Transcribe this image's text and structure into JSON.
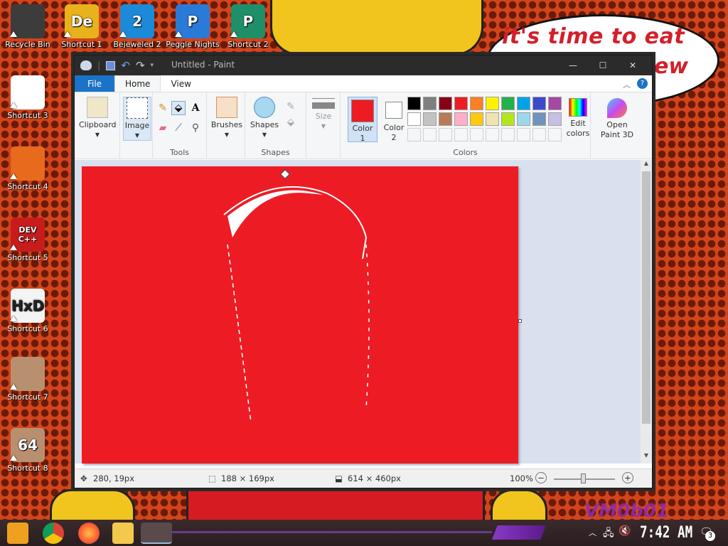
{
  "wallpaper": {
    "bubble_line1": "it's time to eat shit",
    "bubble_line2": "ew",
    "watermark": "VM0b01"
  },
  "desktop_icons": [
    {
      "label": "Recycle Bin",
      "color": "#3c3c3c",
      "glyph": ""
    },
    {
      "label": "Shortcut 1",
      "color": "#e8b21c",
      "glyph": "De"
    },
    {
      "label": "Bejeweled 2",
      "color": "#1c8ad8",
      "glyph": "2"
    },
    {
      "label": "Peggle Nights",
      "color": "#2a7ad8",
      "glyph": "P"
    },
    {
      "label": "Shortcut 2",
      "color": "#1f8f6a",
      "glyph": "P"
    },
    {
      "label": "Shortcut 3",
      "color": "#ffffff",
      "glyph": ""
    },
    {
      "label": "Shortcut 4",
      "color": "#e86a1c",
      "glyph": ""
    },
    {
      "label": "Shortcut 5",
      "color": "#c81c1c",
      "glyph": "DEV C++"
    },
    {
      "label": "Shortcut 6",
      "color": "#f4f4f4",
      "glyph": "HxD"
    },
    {
      "label": "Shortcut 7",
      "color": "#b89070",
      "glyph": ""
    },
    {
      "label": "Shortcut 8",
      "color": "#b89070",
      "glyph": "64"
    }
  ],
  "window": {
    "title": "Untitled - Paint",
    "minimize": "—",
    "maximize": "☐",
    "close": "✕"
  },
  "tabs": {
    "file": "File",
    "home": "Home",
    "view": "View"
  },
  "ribbon": {
    "clipboard": "Clipboard",
    "image": "Image",
    "tools": "Tools",
    "brushes": "Brushes",
    "shapes_btn": "Shapes",
    "shapes_group": "Shapes",
    "size": "Size",
    "color1_label": "Color",
    "color1_num": "1",
    "color2_label": "Color",
    "color2_num": "2",
    "colors_group": "Colors",
    "edit_colors_1": "Edit",
    "edit_colors_2": "colors",
    "open_p3d_1": "Open",
    "open_p3d_2": "Paint 3D",
    "color1_value": "#ed1c24",
    "color2_value": "#ffffff",
    "palette_row1": [
      "#000000",
      "#7f7f7f",
      "#880015",
      "#ed1c24",
      "#ff7f27",
      "#fff200",
      "#22b14c",
      "#00a2e8",
      "#3f48cc",
      "#a349a4"
    ],
    "palette_row2": [
      "#ffffff",
      "#c3c3c3",
      "#b97a57",
      "#ffaec9",
      "#ffc90e",
      "#efe4b0",
      "#b5e61d",
      "#99d9ea",
      "#7092be",
      "#c8bfe7"
    ]
  },
  "status": {
    "cursor_pos": "280, 19px",
    "selection_size": "188 × 169px",
    "canvas_size": "614 × 460px",
    "zoom": "100%"
  },
  "taskbar": {
    "time": "7:42 AM",
    "notification_count": "3"
  }
}
